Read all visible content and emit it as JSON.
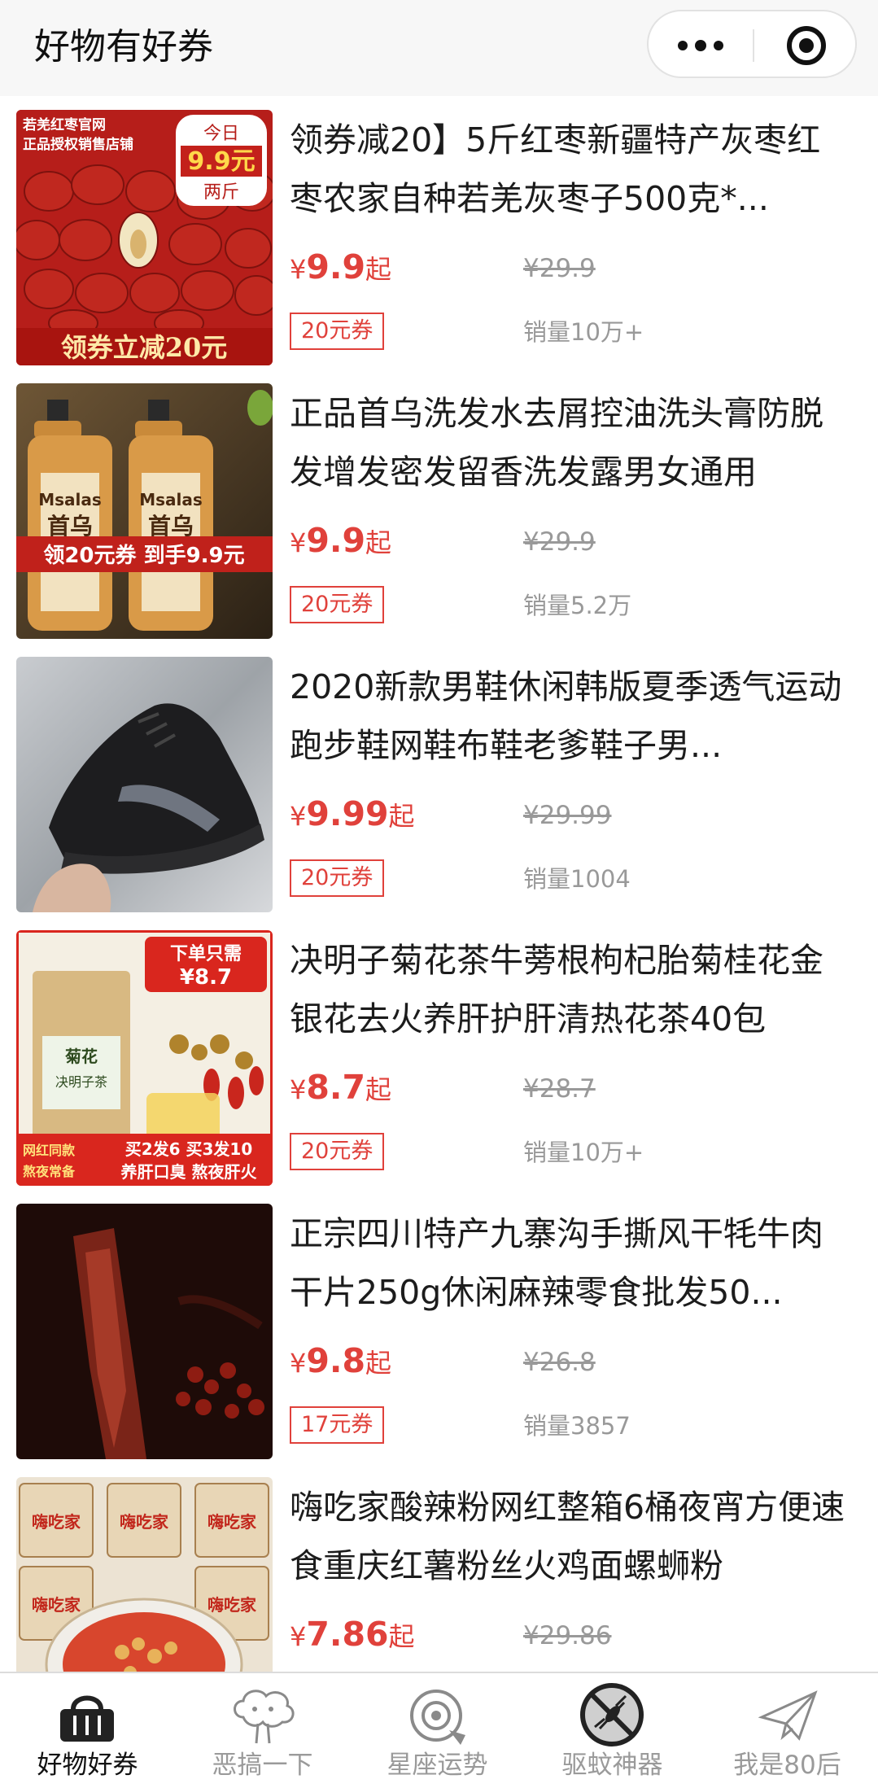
{
  "app": {
    "title": "好物有好券"
  },
  "products": [
    {
      "title": "领券减20】5斤红枣新疆特产灰枣红枣农家自种若羌灰枣子500克*...",
      "currency": "¥",
      "price": "9.9",
      "price_suffix": "起",
      "original_price": "¥29.9",
      "coupon": "20元券",
      "sales": "销量10万+",
      "image_texts": {
        "top_left_1": "若羌红枣官网",
        "top_left_2": "正品授权销售店铺",
        "badge_line1": "今日",
        "badge_price": "9.9元",
        "badge_line3": "两斤",
        "bottom": "领券立减20元"
      }
    },
    {
      "title": "正品首乌洗发水去屑控油洗头膏防脱发增发密发留香洗发露男女通用",
      "currency": "¥",
      "price": "9.9",
      "price_suffix": "起",
      "original_price": "¥29.9",
      "coupon": "20元券",
      "sales": "销量5.2万",
      "image_texts": {
        "banner": "领20元券 到手9.9元",
        "brand": "Msalas",
        "brand_cn": "首乌"
      }
    },
    {
      "title": "2020新款男鞋休闲韩版夏季透气运动跑步鞋网鞋布鞋老爹鞋子男...",
      "currency": "¥",
      "price": "9.99",
      "price_suffix": "起",
      "original_price": "¥29.99",
      "coupon": "20元券",
      "sales": "销量1004"
    },
    {
      "title": "决明子菊花茶牛蒡根枸杞胎菊桂花金银花去火养肝护肝清热花茶40包",
      "currency": "¥",
      "price": "8.7",
      "price_suffix": "起",
      "original_price": "¥28.7",
      "coupon": "20元券",
      "sales": "销量10万+",
      "image_texts": {
        "badge_line1": "下单只需",
        "badge_price": "¥8.7",
        "pack_label1": "菊花",
        "pack_label2": "决明子茶",
        "side1": "网红同款",
        "side2": "熬夜常备",
        "promo": "买2发6 买3发10",
        "bottom": "养肝口臭 熬夜肝火"
      }
    },
    {
      "title": "正宗四川特产九寨沟手撕风干牦牛肉干片250g休闲麻辣零食批发50...",
      "currency": "¥",
      "price": "9.8",
      "price_suffix": "起",
      "original_price": "¥26.8",
      "coupon": "17元券",
      "sales": "销量3857"
    },
    {
      "title": "嗨吃家酸辣粉网红整箱6桶夜宵方便速食重庆红薯粉丝火鸡面螺蛳粉",
      "currency": "¥",
      "price": "7.86",
      "price_suffix": "起",
      "original_price": "¥29.86",
      "coupon": "",
      "sales": "",
      "image_texts": {
        "cup_label": "嗨吃家"
      }
    }
  ],
  "tabbar": [
    {
      "label": "好物好券",
      "icon": "basket-icon",
      "active": true
    },
    {
      "label": "恶搞一下",
      "icon": "cloud-icon",
      "active": false
    },
    {
      "label": "星座运势",
      "icon": "astrology-icon",
      "active": false
    },
    {
      "label": "驱蚊神器",
      "icon": "no-mosquito-icon",
      "active": false
    },
    {
      "label": "我是80后",
      "icon": "paper-plane-icon",
      "active": false
    }
  ],
  "colors": {
    "accent": "#e0413b",
    "muted": "#999999",
    "topbar_bg": "#f7f7f7"
  }
}
